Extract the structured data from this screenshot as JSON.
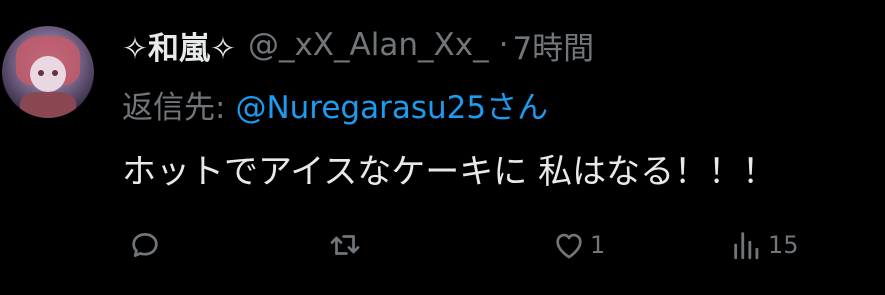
{
  "tweet": {
    "display_name": "✧和嵐✧",
    "handle": "@_xX_Alan_Xx_",
    "separator": "·",
    "time": "7時間",
    "reply_prefix": "返信先:",
    "reply_to": "@Nuregarasu25さん",
    "text": "ホットでアイスなケーキに 私はなる！！！"
  },
  "actions": {
    "reply": {
      "icon": "reply-icon",
      "count": ""
    },
    "retweet": {
      "icon": "retweet-icon",
      "count": ""
    },
    "like": {
      "icon": "heart-icon",
      "count": "1"
    },
    "views": {
      "icon": "views-icon",
      "count": "15"
    }
  },
  "colors": {
    "background": "#000000",
    "primary_text": "#e7e9ea",
    "secondary_text": "#71767b",
    "link": "#1d9bf0"
  }
}
